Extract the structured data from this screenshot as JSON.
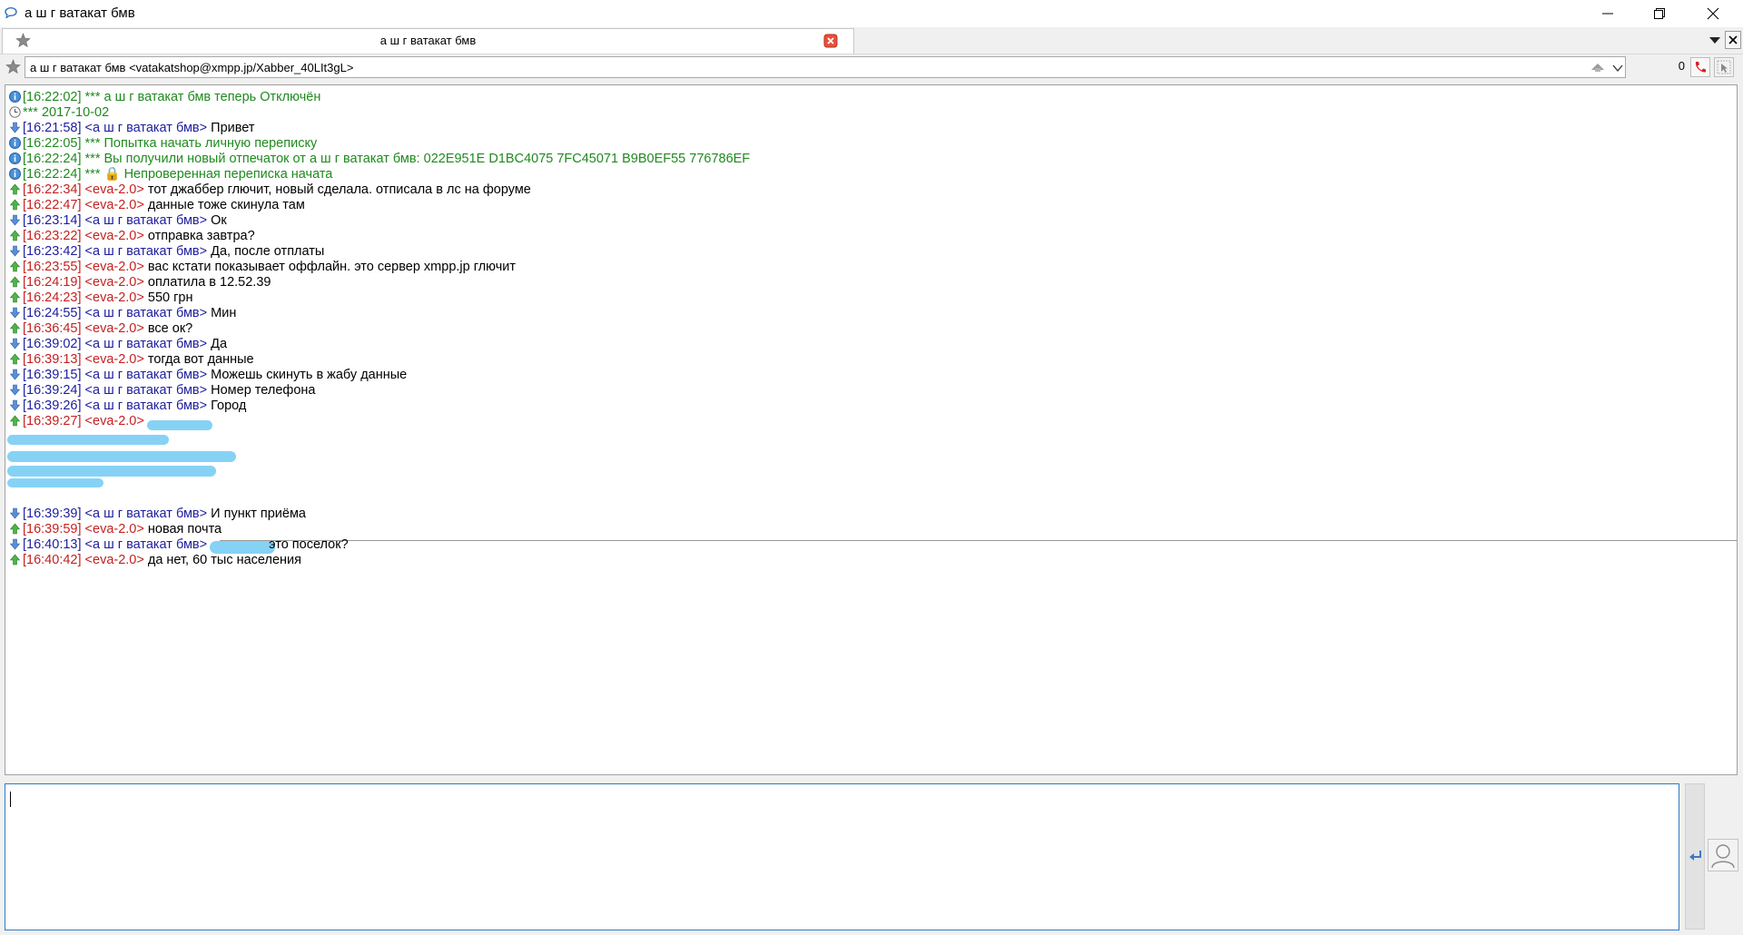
{
  "window": {
    "title": "а ш г ватакат бмв"
  },
  "tab": {
    "label": "а ш г ватакат бмв"
  },
  "contact": {
    "jid_text": "а ш г ватакат бмв <vatakatshop@xmpp.jp/Xabber_40LIt3gL>",
    "counter": "0"
  },
  "colors": {
    "incoming": "#1d1d9e",
    "outgoing": "#c62020",
    "system": "#1f8a1f",
    "redaction": "#7fd0f4",
    "input_border": "#2e7bc4"
  },
  "messages": [
    {
      "ts": "[16:22:02]",
      "nick": "",
      "text": "*** а ш г ватакат бмв теперь Отключён",
      "type": "system",
      "icon": "info-icon"
    },
    {
      "ts": "",
      "nick": "",
      "text": "*** 2017-10-02",
      "type": "system",
      "icon": "clock-icon"
    },
    {
      "ts": "[16:21:58]",
      "nick": "<а ш г ватакат бмв>",
      "text": "Привет",
      "type": "in",
      "icon": "arrow-down-icon"
    },
    {
      "ts": "[16:22:05]",
      "nick": "",
      "text": "*** Попытка начать личную переписку",
      "type": "system",
      "icon": "info-icon"
    },
    {
      "ts": "[16:22:24]",
      "nick": "",
      "text": "*** Вы получили новый отпечаток от а ш г ватакат бмв: 022E951E D1BC4075 7FC45071 B9B0EF55 776786EF",
      "type": "system",
      "icon": "info-icon"
    },
    {
      "ts": "[16:22:24]",
      "nick": "",
      "text": "*** 🔒 Непроверенная переписка начата",
      "type": "system",
      "icon": "info-icon"
    },
    {
      "ts": "[16:22:34]",
      "nick": "<eva-2.0>",
      "text": "тот джаббер глючит, новый сделала. отписала в лс на форуме",
      "type": "out",
      "icon": "arrow-up-icon"
    },
    {
      "ts": "[16:22:47]",
      "nick": "<eva-2.0>",
      "text": "данные тоже скинула там",
      "type": "out",
      "icon": "arrow-up-icon"
    },
    {
      "ts": "[16:23:14]",
      "nick": "<а ш г ватакат бмв>",
      "text": "Ок",
      "type": "in",
      "icon": "arrow-down-icon"
    },
    {
      "ts": "[16:23:22]",
      "nick": "<eva-2.0>",
      "text": "отправка завтра?",
      "type": "out",
      "icon": "arrow-up-icon"
    },
    {
      "ts": "[16:23:42]",
      "nick": "<а ш г ватакат бмв>",
      "text": "Да, после отплаты",
      "type": "in",
      "icon": "arrow-down-icon"
    },
    {
      "ts": "[16:23:55]",
      "nick": "<eva-2.0>",
      "text": "вас кстати показывает оффлайн. это сервер xmpp.jp глючит",
      "type": "out",
      "icon": "arrow-up-icon"
    },
    {
      "ts": "[16:24:19]",
      "nick": "<eva-2.0>",
      "text": "оплатила в 12.52.39",
      "type": "out",
      "icon": "arrow-up-icon"
    },
    {
      "ts": "[16:24:23]",
      "nick": "<eva-2.0>",
      "text": "550 грн",
      "type": "out",
      "icon": "arrow-up-icon"
    },
    {
      "ts": "[16:24:55]",
      "nick": "<а ш г ватакат бмв>",
      "text": "Мин",
      "type": "in",
      "icon": "arrow-down-icon"
    },
    {
      "ts": "[16:36:45]",
      "nick": "<eva-2.0>",
      "text": "все ок?",
      "type": "out",
      "icon": "arrow-up-icon"
    },
    {
      "ts": "[16:39:02]",
      "nick": "<а ш г ватакат бмв>",
      "text": "Да",
      "type": "in",
      "icon": "arrow-down-icon"
    },
    {
      "ts": "[16:39:13]",
      "nick": "<eva-2.0>",
      "text": "тогда вот данные",
      "type": "out",
      "icon": "arrow-up-icon"
    },
    {
      "ts": "[16:39:15]",
      "nick": "<а ш г ватакат бмв>",
      "text": "Можешь скинуть в жабу данные",
      "type": "in",
      "icon": "arrow-down-icon"
    },
    {
      "ts": "[16:39:24]",
      "nick": "<а ш г ватакат бмв>",
      "text": "Номер телефона",
      "type": "in",
      "icon": "arrow-down-icon"
    },
    {
      "ts": "[16:39:26]",
      "nick": "<а ш г ватакат бмв>",
      "text": "Город",
      "type": "in",
      "icon": "arrow-down-icon"
    },
    {
      "ts": "[16:39:27]",
      "nick": "<eva-2.0>",
      "text": "",
      "type": "out",
      "icon": "arrow-up-icon"
    },
    {
      "ts": "[16:39:39]",
      "nick": "<а ш г ватакат бмв>",
      "text": "И пункт приёма",
      "type": "in",
      "icon": "arrow-down-icon"
    },
    {
      "ts": "[16:39:59]",
      "nick": "<eva-2.0>",
      "text": "новая почта",
      "type": "out",
      "icon": "arrow-up-icon"
    },
    {
      "ts": "[16:40:13]",
      "nick": "<а ш г ватакат бмв>",
      "text": "это поселок?",
      "type": "in",
      "icon": "arrow-down-icon"
    },
    {
      "ts": "[16:40:42]",
      "nick": "<eva-2.0>",
      "text": "да нет, 60 тыс населения",
      "type": "out",
      "icon": "arrow-up-icon"
    }
  ],
  "input": {
    "value": ""
  }
}
